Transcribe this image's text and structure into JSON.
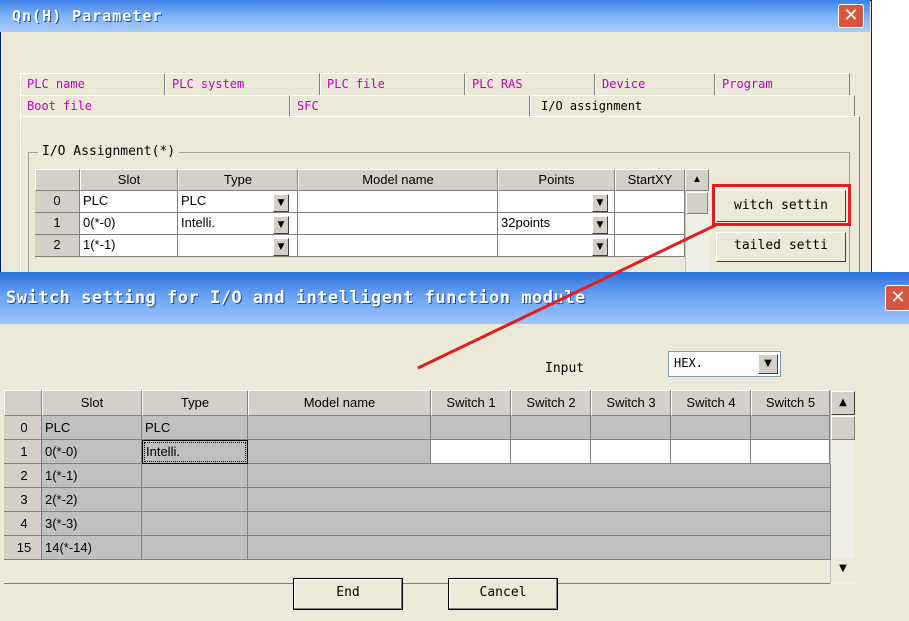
{
  "back_window": {
    "title": "Qn(H) Parameter",
    "close_glyph": "✕",
    "tabs_row1": [
      "PLC name",
      "PLC system",
      "PLC file",
      "PLC RAS",
      "Device",
      "Program"
    ],
    "tabs_row2": [
      "Boot file",
      "SFC",
      "I/O assignment"
    ],
    "group_label": "I/O Assignment(*)",
    "table": {
      "headers": [
        "Slot",
        "Type",
        "Model name",
        "Points",
        "StartXY"
      ],
      "rows": [
        {
          "num": "0",
          "slot": "PLC",
          "type": "PLC",
          "model": "",
          "points": "",
          "start": ""
        },
        {
          "num": "1",
          "slot": "0(*-0)",
          "type": "Intelli.",
          "model": "",
          "points": "32points",
          "start": ""
        },
        {
          "num": "2",
          "slot": "1(*-1)",
          "type": "",
          "model": "",
          "points": "",
          "start": ""
        }
      ]
    },
    "buttons": {
      "switch_setting": "witch settin",
      "detailed_setting": "tailed setti"
    }
  },
  "front_window": {
    "title": "Switch setting for I/O and intelligent function module",
    "close_glyph": "✕",
    "input_label": "Input",
    "input_value": "HEX.",
    "table": {
      "headers": [
        "Slot",
        "Type",
        "Model name",
        "Switch 1",
        "Switch 2",
        "Switch 3",
        "Switch 4",
        "Switch 5"
      ],
      "rows": [
        {
          "num": "0",
          "slot": "PLC",
          "type": "PLC"
        },
        {
          "num": "1",
          "slot": "0(*-0)",
          "type": "Intelli."
        },
        {
          "num": "2",
          "slot": "1(*-1)",
          "type": ""
        },
        {
          "num": "3",
          "slot": "2(*-2)",
          "type": ""
        },
        {
          "num": "4",
          "slot": "3(*-3)",
          "type": ""
        },
        {
          "num": "15",
          "slot": "14(*-14)",
          "type": ""
        }
      ]
    },
    "buttons": {
      "end": "End",
      "cancel": "Cancel"
    }
  },
  "colors": {
    "highlight_box": "#e02020",
    "annotation_arrow": "#e02020",
    "tab_text": "#c000c0"
  },
  "icons": {
    "dropdown": "▼",
    "scroll_up": "▲",
    "scroll_down": "▼"
  }
}
